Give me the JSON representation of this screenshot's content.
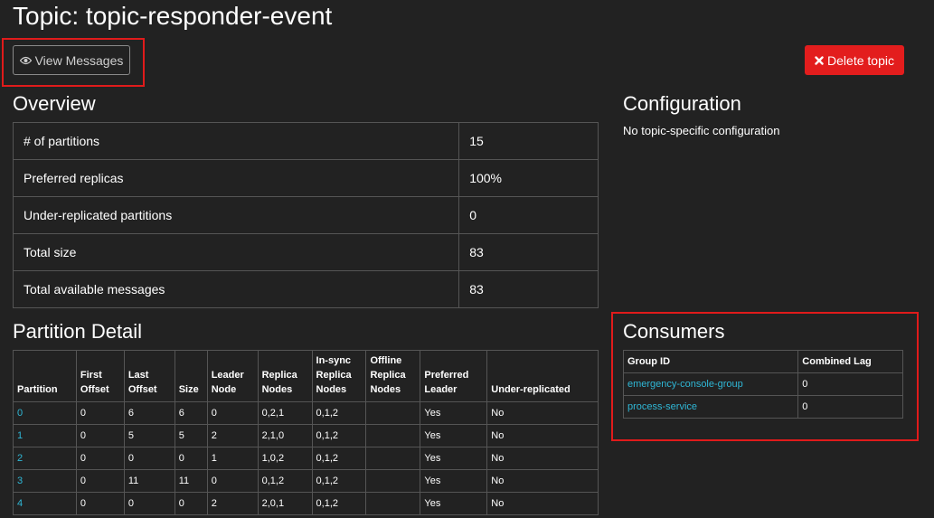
{
  "page": {
    "title": "Topic: topic-responder-event"
  },
  "actions": {
    "view_messages": "View Messages",
    "delete_topic": "Delete topic"
  },
  "overview": {
    "heading": "Overview",
    "rows": [
      {
        "label": "# of partitions",
        "value": "15"
      },
      {
        "label": "Preferred replicas",
        "value": "100%"
      },
      {
        "label": "Under-replicated partitions",
        "value": "0"
      },
      {
        "label": "Total size",
        "value": "83"
      },
      {
        "label": "Total available messages",
        "value": "83"
      }
    ]
  },
  "configuration": {
    "heading": "Configuration",
    "text": "No topic-specific configuration"
  },
  "partition_detail": {
    "heading": "Partition Detail",
    "headers": [
      "Partition",
      "First Offset",
      "Last Offset",
      "Size",
      "Leader Node",
      "Replica Nodes",
      "In-sync Replica Nodes",
      "Offline Replica Nodes",
      "Preferred Leader",
      "Under-replicated"
    ],
    "rows": [
      [
        "0",
        "0",
        "6",
        "6",
        "0",
        "0,2,1",
        "0,1,2",
        "",
        "Yes",
        "No"
      ],
      [
        "1",
        "0",
        "5",
        "5",
        "2",
        "2,1,0",
        "0,1,2",
        "",
        "Yes",
        "No"
      ],
      [
        "2",
        "0",
        "0",
        "0",
        "1",
        "1,0,2",
        "0,1,2",
        "",
        "Yes",
        "No"
      ],
      [
        "3",
        "0",
        "11",
        "11",
        "0",
        "0,1,2",
        "0,1,2",
        "",
        "Yes",
        "No"
      ],
      [
        "4",
        "0",
        "0",
        "0",
        "2",
        "2,0,1",
        "0,1,2",
        "",
        "Yes",
        "No"
      ]
    ]
  },
  "consumers": {
    "heading": "Consumers",
    "headers": [
      "Group ID",
      "Combined Lag"
    ],
    "rows": [
      [
        "emergency-console-group",
        "0"
      ],
      [
        "process-service",
        "0"
      ]
    ]
  },
  "colors": {
    "background": "#222222",
    "link": "#2fb7d6",
    "danger": "#e31d1d",
    "highlight": "#e01b1b"
  }
}
